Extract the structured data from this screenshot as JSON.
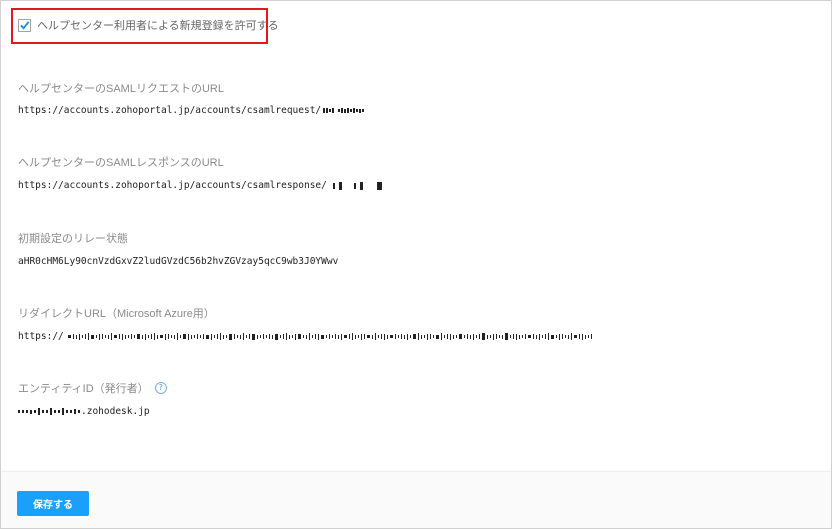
{
  "checkbox": {
    "label": "ヘルプセンター利用者による新規登録を許可する",
    "checked": true
  },
  "fields": {
    "saml_request": {
      "label": "ヘルプセンターのSAMLリクエストのURL",
      "value": "https://accounts.zohoportal.jp/accounts/csamlrequest/"
    },
    "saml_response": {
      "label": "ヘルプセンターのSAMLレスポンスのURL",
      "value": "https://accounts.zohoportal.jp/accounts/csamlresponse/"
    },
    "relay_state": {
      "label": "初期設定のリレー状態",
      "value": "aHR0cHM6Ly90cnVzdGxvZ2ludGVzdC56b2hvZGVzay5qcC9wb3J0YWwv"
    },
    "redirect_url": {
      "label": "リダイレクトURL（Microsoft Azure用）",
      "value": "https://"
    },
    "entity_id": {
      "label": "エンティティID（発行者）",
      "value": ".zohodesk.jp"
    }
  },
  "save_button": "保存する",
  "colors": {
    "accent": "#18a0fb",
    "highlight": "#e0191e"
  },
  "icons": {
    "checkbox": "check-icon",
    "help": "help-icon"
  }
}
